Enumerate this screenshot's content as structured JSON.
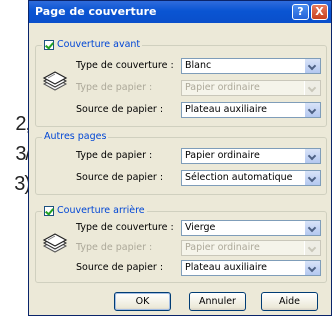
{
  "background_text": [
    "2,",
    "3/",
    "3)"
  ],
  "window": {
    "title": "Page de couverture",
    "help_label": "?",
    "close_label": "X"
  },
  "front_cover": {
    "legend": "Couverture avant",
    "checked": true,
    "rows": [
      {
        "label": "Type de couverture :",
        "value": "Blanc",
        "enabled": true
      },
      {
        "label": "Type de papier :",
        "value": "Papier ordinaire",
        "enabled": false
      },
      {
        "label": "Source de papier :",
        "value": "Plateau auxiliaire",
        "enabled": true
      }
    ]
  },
  "other_pages": {
    "legend": "Autres pages",
    "rows": [
      {
        "label": "Type de papier :",
        "value": "Papier ordinaire",
        "enabled": true
      },
      {
        "label": "Source de papier :",
        "value": "Sélection automatique",
        "enabled": true
      }
    ]
  },
  "back_cover": {
    "legend": "Couverture arrière",
    "checked": true,
    "rows": [
      {
        "label": "Type de couverture :",
        "value": "Vierge",
        "enabled": true
      },
      {
        "label": "Type de papier :",
        "value": "Papier ordinaire",
        "enabled": false
      },
      {
        "label": "Source de papier :",
        "value": "Plateau auxiliaire",
        "enabled": true
      }
    ]
  },
  "buttons": {
    "ok": "OK",
    "cancel": "Annuler",
    "help": "Aide"
  },
  "icons": [
    "paper-stack-icon",
    "paper-stack-icon"
  ],
  "colors": {
    "titlebar": "#0a55d3",
    "dialog_bg": "#ece9d8",
    "group_title": "#0046d5"
  }
}
